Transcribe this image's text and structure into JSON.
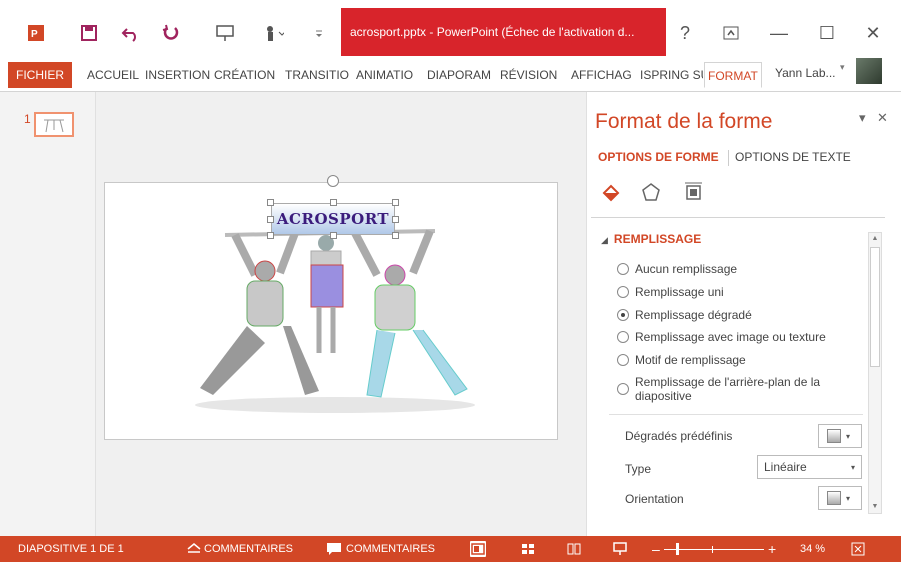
{
  "window": {
    "title": "acrosport.pptx - PowerPoint (Échec de l'activation d...",
    "help": "?",
    "minimize": "—",
    "maximize": "☐",
    "close": "✕"
  },
  "ribbon": {
    "tabs": [
      "FICHIER",
      "ACCUEIL",
      "INSERTION",
      "CRÉATION",
      "TRANSITIO",
      "ANIMATIO",
      "DIAPORAM",
      "RÉVISION",
      "AFFICHAG",
      "ISPRING SU",
      "FORMAT"
    ],
    "active_tab": "FORMAT",
    "user": "Yann Lab..."
  },
  "thumbnails": {
    "slide_number": "1"
  },
  "slide": {
    "wordart_text": "ACROSPORT"
  },
  "format_pane": {
    "title": "Format de la forme",
    "tabs": [
      "OPTIONS DE FORME",
      "OPTIONS DE TEXTE"
    ],
    "section": "REMPLISSAGE",
    "fill_options": [
      {
        "label": "Aucun remplissage",
        "checked": false
      },
      {
        "label": "Remplissage uni",
        "checked": false
      },
      {
        "label": "Remplissage dégradé",
        "checked": true
      },
      {
        "label": "Remplissage avec image ou texture",
        "checked": false
      },
      {
        "label": "Motif de remplissage",
        "checked": false
      },
      {
        "label": "Remplissage de l'arrière-plan de la diapositive",
        "checked": false
      }
    ],
    "properties": {
      "preset_label": "Dégradés prédéfinis",
      "type_label": "Type",
      "type_value": "Linéaire",
      "orientation_label": "Orientation"
    }
  },
  "statusbar": {
    "slide_info": "DIAPOSITIVE 1 DE 1",
    "notes": "COMMENTAIRES",
    "comments": "COMMENTAIRES",
    "zoom": "34 %"
  },
  "colors": {
    "accent": "#d24726",
    "title_bar_red": "#d8242b",
    "status_bar": "#d24726"
  }
}
